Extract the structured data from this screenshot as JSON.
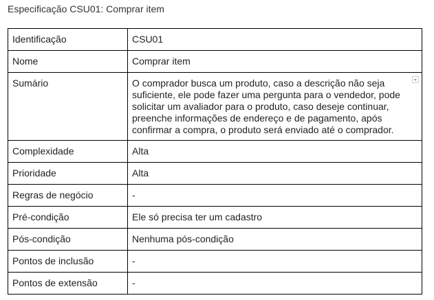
{
  "title": "Especificação CSU01: Comprar item",
  "rows": [
    {
      "label": "Identificação",
      "value": "CSU01"
    },
    {
      "label": "Nome",
      "value": "Comprar item"
    },
    {
      "label": "Sumário",
      "value": "O comprador busca um produto, caso a descrição não seja suficiente, ele pode fazer uma pergunta para o vendedor, pode solicitar um avaliador para o produto, caso deseje continuar, preenche informações de endereço e de pagamento, após confirmar a compra, o produto será enviado até o comprador."
    },
    {
      "label": "Complexidade",
      "value": "Alta"
    },
    {
      "label": "Prioridade",
      "value": "Alta"
    },
    {
      "label": "Regras de negócio",
      "value": "-"
    },
    {
      "label": "Pré-condição",
      "value": "Ele só precisa ter um cadastro"
    },
    {
      "label": "Pós-condição",
      "value": "Nenhuma pós-condição"
    },
    {
      "label": "Pontos de inclusão",
      "value": "-"
    },
    {
      "label": "Pontos de extensão",
      "value": "-"
    }
  ],
  "icons": {
    "summary_cell_marker": "chevron-down-icon"
  }
}
